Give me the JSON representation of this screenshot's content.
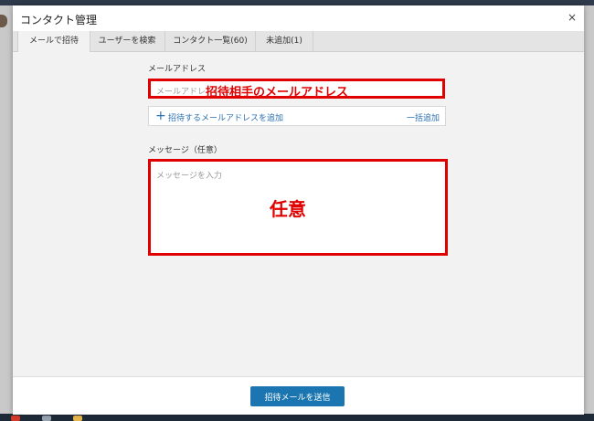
{
  "dialog": {
    "title": "コンタクト管理",
    "close_label": "×"
  },
  "tabs": [
    {
      "label": "メールで招待"
    },
    {
      "label": "ユーザーを検索"
    },
    {
      "label": "コンタクト一覧(60)"
    },
    {
      "label": "未追加(1)"
    }
  ],
  "email": {
    "label": "メールアドレス",
    "placeholder": "メールアドレ",
    "annotation": "招待相手のメールアドレス"
  },
  "add_row": {
    "label": "招待するメールアドレスを追加",
    "bulk_label": "一括追加"
  },
  "message": {
    "label": "メッセージ（任意）",
    "placeholder": "メッセージを入力",
    "annotation": "任意"
  },
  "footer": {
    "send_label": "招待メールを送信"
  },
  "colors": {
    "accent": "#1a75b0",
    "annotation_red": "#e00000"
  }
}
